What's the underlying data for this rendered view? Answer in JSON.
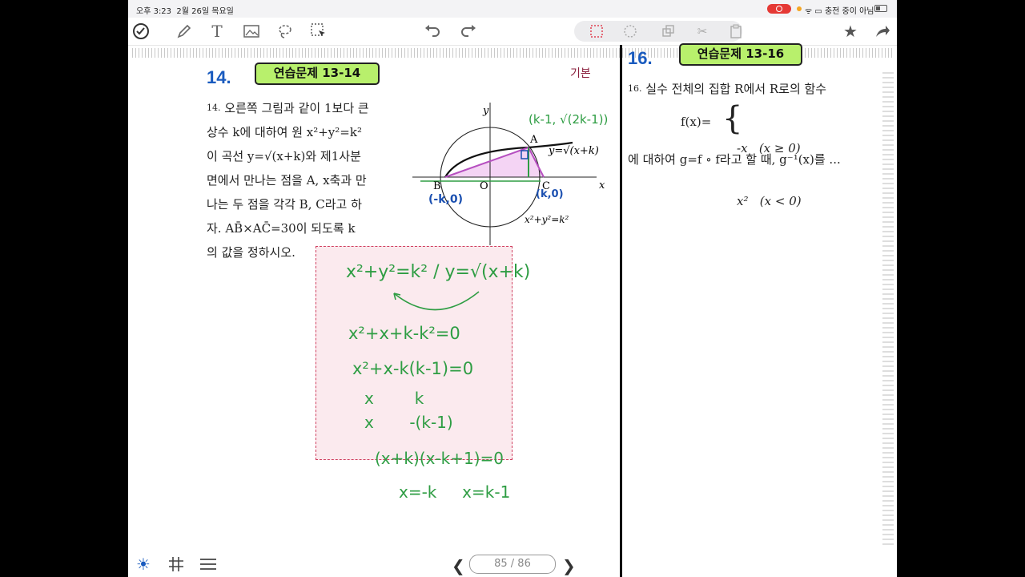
{
  "status_bar": {
    "time": "오후 3:23",
    "date": "2월 26일 목요일",
    "right_text": "충전 중이 아님"
  },
  "toolbar": {
    "left_icons": [
      "checkmark-circle-icon",
      "pen-icon",
      "text-icon",
      "image-icon",
      "lasso-icon",
      "selection-arrow-icon"
    ],
    "center_icons": [
      "undo-icon",
      "redo-icon"
    ],
    "tool_group": [
      "rect-select-icon",
      "circle-select-icon",
      "copy-icon",
      "scissors-icon",
      "paste-icon"
    ],
    "right_icons": [
      "star-icon",
      "share-icon"
    ]
  },
  "left_page": {
    "number": "14.",
    "badge": "연습문제 13-14",
    "level": "기본",
    "problem_number": "14.",
    "lines": [
      "오른쪽 그림과 같이 1보다 큰",
      "상수 k에 대하여 원 x²+y²=k²",
      "이 곡선 y=√(x+k)와 제1사분",
      "면에서 만나는 점을 A, x축과 만",
      "나는 두 점을 각각 B, C라고 하",
      "자. AB̄×AC̄=30이 되도록 k",
      "의 값을 정하시오."
    ],
    "figure": {
      "y_axis": "y",
      "x_axis": "x",
      "point_A": "A",
      "point_B": "B",
      "point_O": "O",
      "point_C": "C",
      "curve_label": "y=√(x+k)",
      "circle_label": "x²+y²=k²",
      "hw_A": "(k-1, √(2k-1))",
      "hw_B": "(-k,0)",
      "hw_C": "(k,0)"
    },
    "work": [
      "x²+y²=k² / y=√(x+k)",
      "x²+x+k-k²=0",
      "x²+x-k(k-1)=0",
      "x        k",
      "x       -(k-1)",
      "(x+k)(x-k+1)=0",
      "x=-k     x=k-1"
    ]
  },
  "right_page": {
    "number": "16.",
    "badge": "연습문제 13-16",
    "problem_number": "16.",
    "line1": "실수 전체의 집합 R에서 R로의 함수",
    "func_name": "f(x)=",
    "case1": "-x   (x ≥ 0)",
    "case2": "x²   (x < 0)",
    "line2": "에 대하여 g=f ∘ f라고 할 때, g⁻¹(x)를 ..."
  },
  "bottom": {
    "page_indicator": "85 / 86"
  }
}
